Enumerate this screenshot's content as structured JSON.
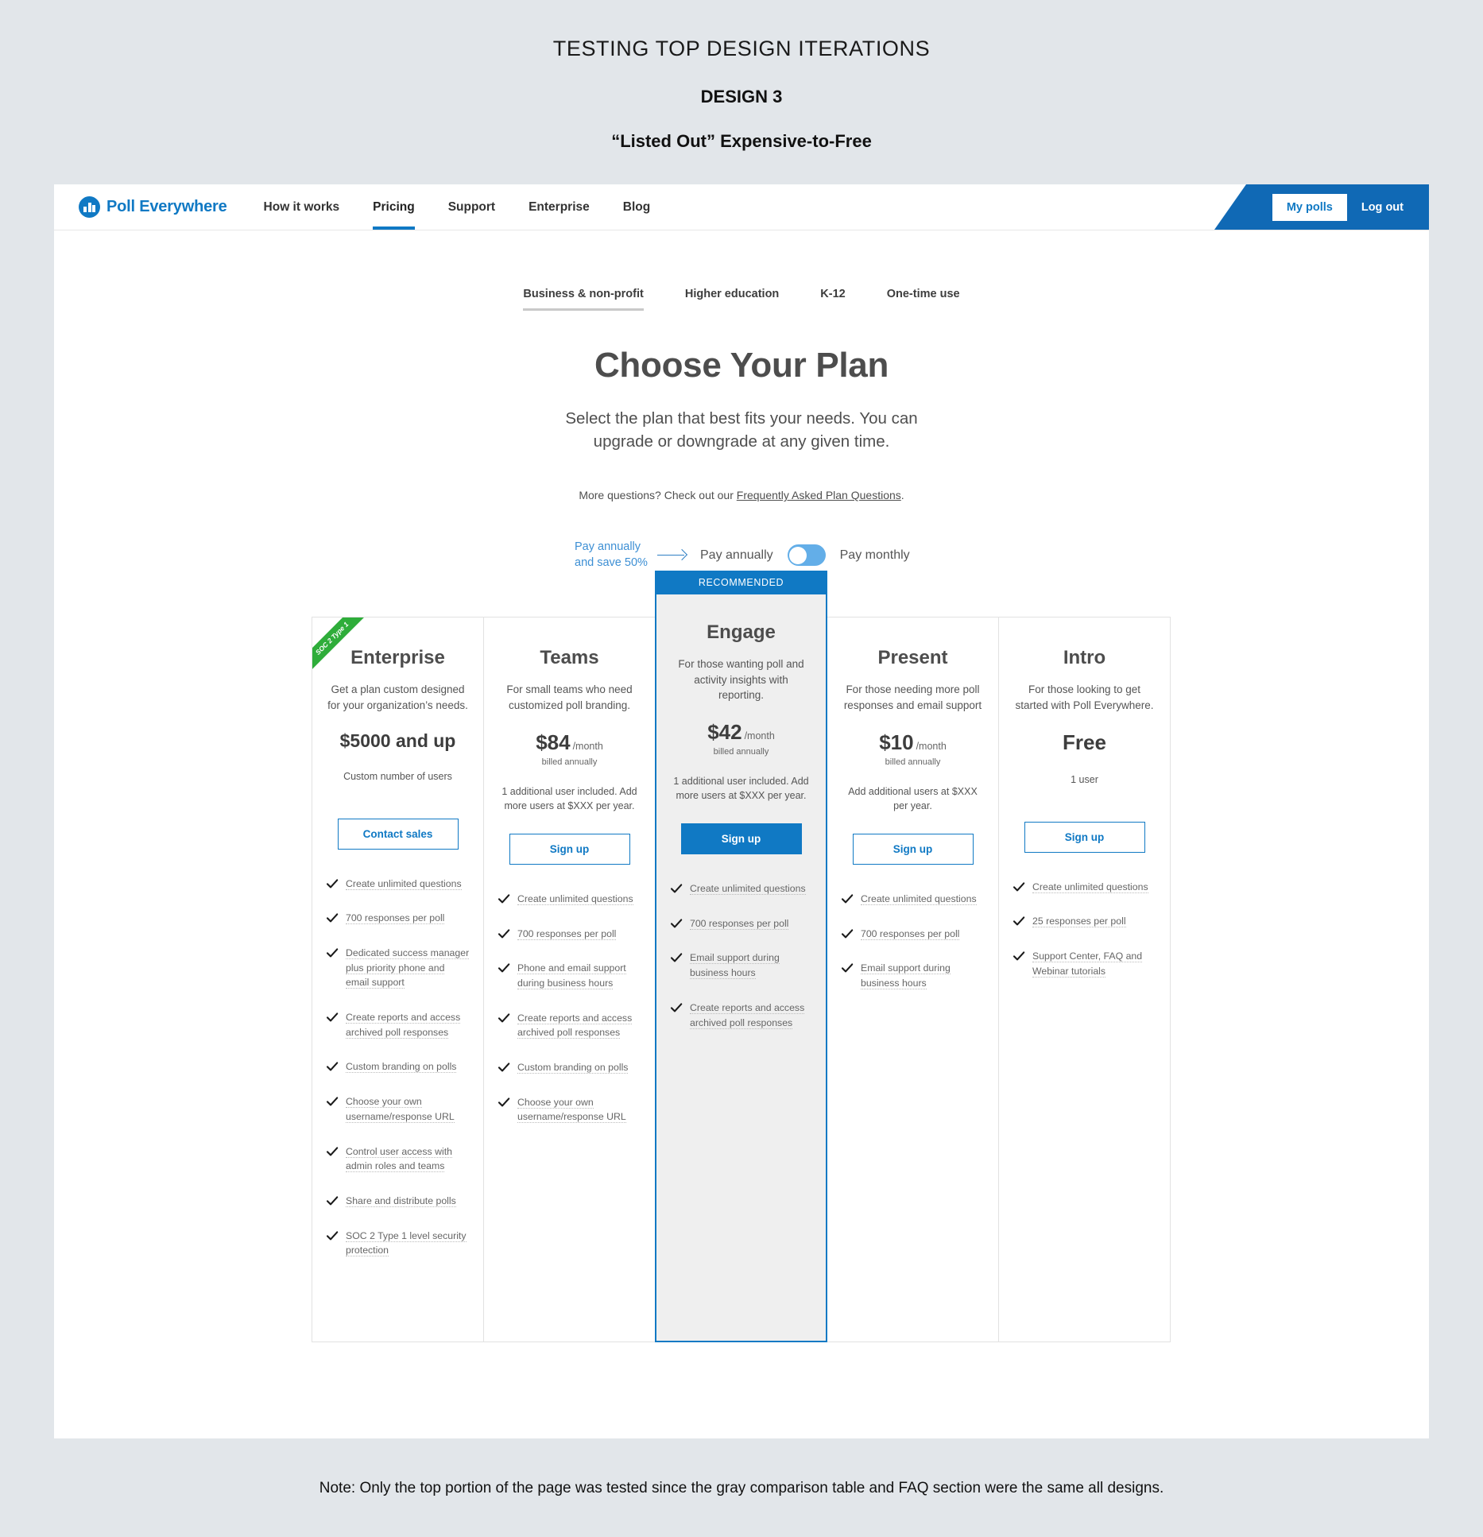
{
  "slide": {
    "title": "TESTING TOP DESIGN ITERATIONS",
    "subtitle": "DESIGN 3",
    "subtitle2": "“Listed Out” Expensive-to-Free",
    "note": "Note: Only the top portion of the page was tested since the gray comparison table and FAQ section were the same all designs."
  },
  "colors": {
    "brand_blue": "#1079c4",
    "nav_blue": "#1069b5",
    "toggle_blue": "#63aee8",
    "ribbon_green": "#2ead3a",
    "page_bg": "#e2e6ea",
    "featured_bg": "#efefef"
  },
  "nav": {
    "logo_text": "Poll Everywhere",
    "links": [
      {
        "label": "How it works",
        "active": false
      },
      {
        "label": "Pricing",
        "active": true
      },
      {
        "label": "Support",
        "active": false
      },
      {
        "label": "Enterprise",
        "active": false
      },
      {
        "label": "Blog",
        "active": false
      }
    ],
    "my_polls": "My polls",
    "log_out": "Log out"
  },
  "plan_tabs": [
    {
      "label": "Business & non-profit",
      "active": true
    },
    {
      "label": "Higher education",
      "active": false
    },
    {
      "label": "K-12",
      "active": false
    },
    {
      "label": "One-time use",
      "active": false
    }
  ],
  "hero": {
    "heading": "Choose Your Plan",
    "lede": "Select the plan that best fits your needs. You can upgrade or downgrade at any given time.",
    "more_prefix": "More questions? Check out our ",
    "more_link": "Frequently Asked Plan Questions",
    "more_suffix": "."
  },
  "billing": {
    "save_note": "Pay annually and save 50%",
    "annually_label": "Pay annually",
    "monthly_label": "Pay monthly",
    "selected": "Pay annually"
  },
  "recommended_banner": "RECOMMENDED",
  "ribbon_label": "SOC 2 Type 1",
  "plans": [
    {
      "name": "Enterprise",
      "desc": "Get a plan custom designed for your organization’s needs.",
      "price": "$5000 and up",
      "per": "",
      "billed": "",
      "users": "Custom number of users",
      "cta": "Contact sales",
      "cta_style": "outline",
      "featured": false,
      "ribbon": true,
      "features": [
        "Create unlimited questions",
        "700 responses per poll",
        "Dedicated success manager plus priority phone and email support",
        "Create reports and access archived poll responses",
        "Custom branding on polls",
        "Choose your own username/response URL",
        "Control user access with admin roles and teams",
        "Share and distribute polls",
        "SOC 2 Type 1 level security protection"
      ]
    },
    {
      "name": "Teams",
      "desc": "For small teams who need customized poll branding.",
      "price": "$84",
      "per": "/month",
      "billed": "billed annually",
      "users": "1 additional user included. Add more users at $XXX per year.",
      "cta": "Sign up",
      "cta_style": "outline",
      "featured": false,
      "ribbon": false,
      "features": [
        "Create unlimited questions",
        "700 responses per poll",
        "Phone and email support during business hours",
        "Create reports and access archived poll responses",
        "Custom branding on polls",
        "Choose your own username/response URL"
      ]
    },
    {
      "name": "Engage",
      "desc": "For those wanting poll and activity insights with reporting.",
      "price": "$42",
      "per": "/month",
      "billed": "billed annually",
      "users": "1 additional user included. Add more users at $XXX per year.",
      "cta": "Sign up",
      "cta_style": "filled",
      "featured": true,
      "ribbon": false,
      "features": [
        "Create unlimited questions",
        "700 responses per poll",
        "Email support during business hours",
        "Create reports and access archived poll responses"
      ]
    },
    {
      "name": "Present",
      "desc": "For those needing more poll responses and email support",
      "price": "$10",
      "per": "/month",
      "billed": "billed annually",
      "users": "Add additional users at $XXX per year.",
      "cta": "Sign up",
      "cta_style": "outline",
      "featured": false,
      "ribbon": false,
      "features": [
        "Create unlimited questions",
        "700 responses per poll",
        "Email support during business hours"
      ]
    },
    {
      "name": "Intro",
      "desc": "For those looking to get started with Poll Everywhere.",
      "price": "Free",
      "per": "",
      "billed": "",
      "users": "1 user",
      "cta": "Sign up",
      "cta_style": "outline",
      "featured": false,
      "ribbon": false,
      "features": [
        "Create unlimited questions",
        "25 responses per poll",
        "Support Center, FAQ and Webinar tutorials"
      ]
    }
  ]
}
